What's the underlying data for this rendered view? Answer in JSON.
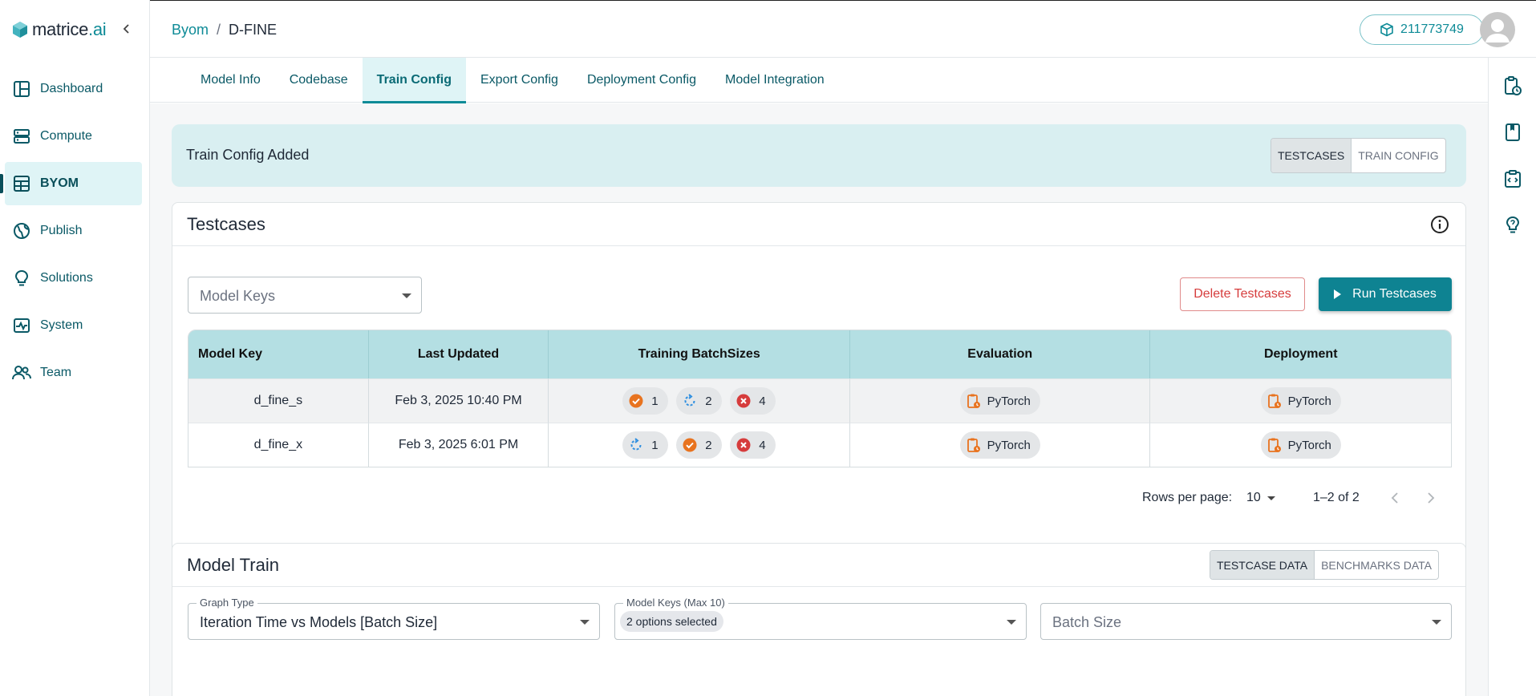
{
  "brand": {
    "name_main": "matrice",
    "name_accent": ".ai"
  },
  "sidebar": {
    "items": [
      {
        "label": "Dashboard",
        "icon": "dashboard-icon"
      },
      {
        "label": "Compute",
        "icon": "server-icon"
      },
      {
        "label": "BYOM",
        "icon": "byom-icon",
        "active": true
      },
      {
        "label": "Publish",
        "icon": "globe-icon"
      },
      {
        "label": "Solutions",
        "icon": "lightbulb-icon"
      },
      {
        "label": "System",
        "icon": "pulse-icon"
      },
      {
        "label": "Team",
        "icon": "team-icon"
      }
    ]
  },
  "header": {
    "breadcrumb": {
      "parent": "Byom",
      "separator": "/",
      "current": "D-FINE"
    },
    "credits": "211773749"
  },
  "tabs": [
    {
      "label": "Model Info"
    },
    {
      "label": "Codebase"
    },
    {
      "label": "Train Config",
      "active": true
    },
    {
      "label": "Export Config"
    },
    {
      "label": "Deployment Config"
    },
    {
      "label": "Model Integration"
    }
  ],
  "banner": {
    "title": "Train Config Added",
    "toggle": [
      "TESTCASES",
      "TRAIN CONFIG"
    ],
    "selected": "TESTCASES"
  },
  "testcases": {
    "title": "Testcases",
    "model_keys_placeholder": "Model Keys",
    "delete_label": "Delete Testcases",
    "run_label": "Run Testcases",
    "columns": [
      "Model Key",
      "Last Updated",
      "Training BatchSizes",
      "Evaluation",
      "Deployment"
    ],
    "rows": [
      {
        "model_key": "d_fine_s",
        "last_updated": "Feb 3, 2025 10:40 PM",
        "batches": [
          {
            "status": "success",
            "value": "1"
          },
          {
            "status": "running",
            "value": "2"
          },
          {
            "status": "failed",
            "value": "4"
          }
        ],
        "evaluation": "PyTorch",
        "deployment": "PyTorch"
      },
      {
        "model_key": "d_fine_x",
        "last_updated": "Feb 3, 2025 6:01 PM",
        "batches": [
          {
            "status": "running",
            "value": "1"
          },
          {
            "status": "success",
            "value": "2"
          },
          {
            "status": "failed",
            "value": "4"
          }
        ],
        "evaluation": "PyTorch",
        "deployment": "PyTorch"
      }
    ],
    "pagination": {
      "rows_label": "Rows per page:",
      "rows_value": "10",
      "range": "1–2 of 2"
    }
  },
  "model_train": {
    "title": "Model Train",
    "toggle": [
      "TESTCASE DATA",
      "BENCHMARKS DATA"
    ],
    "selected": "TESTCASE DATA",
    "graph_type_label": "Graph Type",
    "graph_type_value": "Iteration Time vs Models [Batch Size]",
    "model_keys_label": "Model Keys (Max 10)",
    "model_keys_value": "2 options selected",
    "batch_size_placeholder": "Batch Size"
  },
  "colors": {
    "accent": "#0e8b97",
    "success": "#e8731f",
    "running": "#2f8fe0",
    "failed": "#d63c3c"
  }
}
